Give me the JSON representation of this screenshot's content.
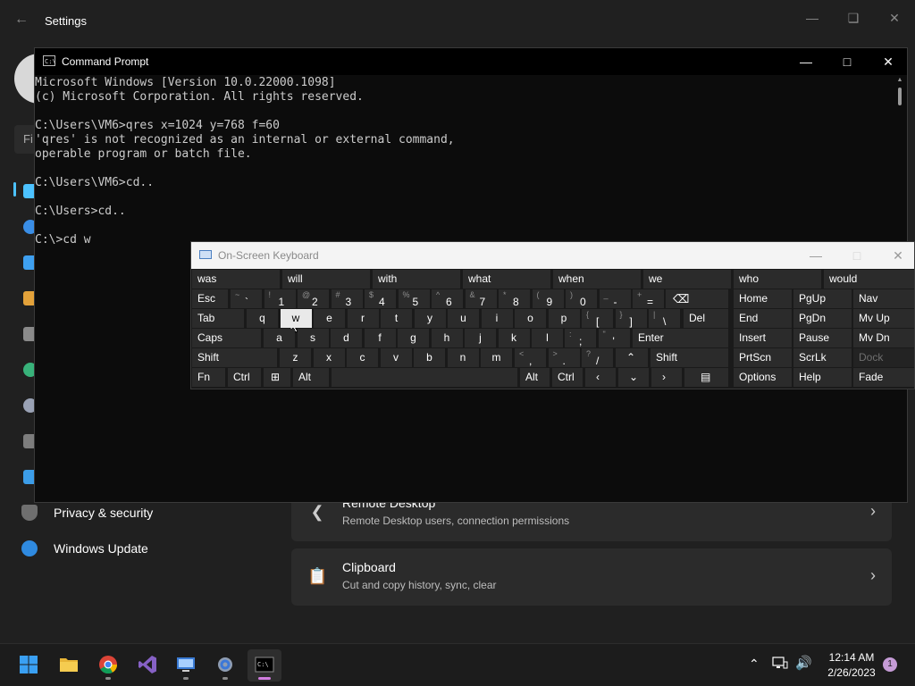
{
  "settings": {
    "title": "Settings",
    "back_icon": "back-arrow-icon",
    "find_placeholder": "Fi",
    "nav": [
      {
        "label": "Privacy & security",
        "icon": "shield-icon"
      },
      {
        "label": "Windows Update",
        "icon": "windows-update-icon"
      }
    ],
    "cards": [
      {
        "title": "Remote Desktop",
        "subtitle": "Remote Desktop users, connection permissions",
        "icon": "remote-desktop-icon"
      },
      {
        "title": "Clipboard",
        "subtitle": "Cut and copy history, sync, clear",
        "icon": "clipboard-icon"
      }
    ]
  },
  "cmd": {
    "title": "Command Prompt",
    "lines": [
      "Microsoft Windows [Version 10.0.22000.1098]",
      "(c) Microsoft Corporation. All rights reserved.",
      "",
      "C:\\Users\\VM6>qres x=1024 y=768 f=60",
      "'qres' is not recognized as an internal or external command,",
      "operable program or batch file.",
      "",
      "C:\\Users\\VM6>cd..",
      "",
      "C:\\Users>cd..",
      "",
      "C:\\>cd w"
    ]
  },
  "osk": {
    "title": "On-Screen Keyboard",
    "predictions": [
      "was",
      "will",
      "with",
      "what",
      "when",
      "we",
      "who",
      "would"
    ],
    "keys": {
      "esc": "Esc",
      "tab": "Tab",
      "caps": "Caps",
      "shift": "Shift",
      "fn": "Fn",
      "ctrl": "Ctrl",
      "alt": "Alt",
      "del": "Del",
      "enter": "Enter",
      "home": "Home",
      "pgup": "PgUp",
      "nav": "Nav",
      "end": "End",
      "pgdn": "PgDn",
      "mvup": "Mv Up",
      "insert": "Insert",
      "pause": "Pause",
      "mvdn": "Mv Dn",
      "prtscn": "PrtScn",
      "scrlk": "ScrLk",
      "dock": "Dock",
      "options": "Options",
      "help": "Help",
      "fade": "Fade",
      "row2": [
        "q",
        "w",
        "e",
        "r",
        "t",
        "y",
        "u",
        "i",
        "o",
        "p"
      ],
      "row3": [
        "a",
        "s",
        "d",
        "f",
        "g",
        "h",
        "j",
        "k",
        "l"
      ],
      "row4": [
        "z",
        "x",
        "c",
        "v",
        "b",
        "n",
        "m"
      ],
      "numrow": [
        {
          "sub": "~",
          "main": "`"
        },
        {
          "sub": "!",
          "main": "1"
        },
        {
          "sub": "@",
          "main": "2"
        },
        {
          "sub": "#",
          "main": "3"
        },
        {
          "sub": "$",
          "main": "4"
        },
        {
          "sub": "%",
          "main": "5"
        },
        {
          "sub": "^",
          "main": "6"
        },
        {
          "sub": "&",
          "main": "7"
        },
        {
          "sub": "*",
          "main": "8"
        },
        {
          "sub": "(",
          "main": "9"
        },
        {
          "sub": ")",
          "main": "0"
        },
        {
          "sub": "_",
          "main": "-"
        },
        {
          "sub": "+",
          "main": "="
        }
      ],
      "brackets": [
        {
          "sub": "{",
          "main": "["
        },
        {
          "sub": "}",
          "main": "]"
        },
        {
          "sub": "|",
          "main": "\\"
        }
      ],
      "semis": [
        {
          "sub": ":",
          "main": ";"
        },
        {
          "sub": "\"",
          "main": "'"
        }
      ],
      "commas": [
        {
          "sub": "<",
          "main": ","
        },
        {
          "sub": ">",
          "main": "."
        },
        {
          "sub": "?",
          "main": "/"
        }
      ]
    }
  },
  "taskbar": {
    "apps": [
      "start-icon",
      "file-explorer-icon",
      "chrome-icon",
      "visual-studio-icon",
      "remote-desktop-app-icon",
      "settings-gear-icon",
      "terminal-icon"
    ],
    "time": "12:14 AM",
    "date": "2/26/2023",
    "notification_count": "1"
  },
  "colors": {
    "accent": "#4cc2ff",
    "cmd_bg": "#0c0c0c",
    "osk_key": "#2b2b2b",
    "active_indicator": "#d17de0"
  }
}
